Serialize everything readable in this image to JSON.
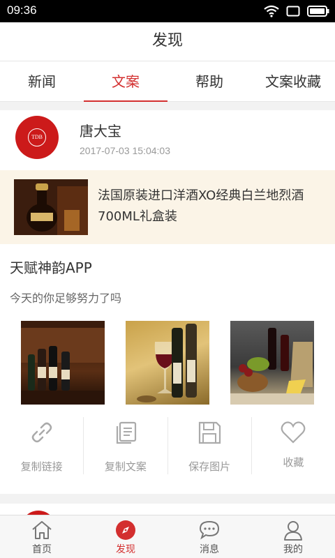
{
  "status_bar": {
    "time": "09:36"
  },
  "header": {
    "title": "发现"
  },
  "tabs": [
    {
      "label": "新闻",
      "active": false
    },
    {
      "label": "文案",
      "active": true
    },
    {
      "label": "帮助",
      "active": false
    },
    {
      "label": "文案收藏",
      "active": false
    }
  ],
  "post": {
    "author": "唐大宝",
    "avatar_text": "TDB",
    "time": "2017-07-03 15:04:03",
    "product_title": "法国原装进口洋酒XO经典白兰地烈酒700ML礼盒装",
    "app_name": "天赋神韵APP",
    "slogan": "今天的你足够努力了吗",
    "images": [
      "wine-cellar-bottles",
      "wine-bottles-glass",
      "wine-still-life"
    ],
    "actions": [
      {
        "label": "复制链接",
        "icon": "link-icon"
      },
      {
        "label": "复制文案",
        "icon": "copy-icon"
      },
      {
        "label": "保存图片",
        "icon": "save-icon"
      },
      {
        "label": "收藏",
        "icon": "heart-icon"
      }
    ]
  },
  "bottom_nav": [
    {
      "label": "首页",
      "icon": "home-icon",
      "active": false
    },
    {
      "label": "发现",
      "icon": "compass-icon",
      "active": true
    },
    {
      "label": "消息",
      "icon": "message-icon",
      "active": false
    },
    {
      "label": "我的",
      "icon": "user-icon",
      "active": false
    }
  ],
  "colors": {
    "accent": "#d32f2f",
    "product_bg": "#fbf4e7"
  }
}
